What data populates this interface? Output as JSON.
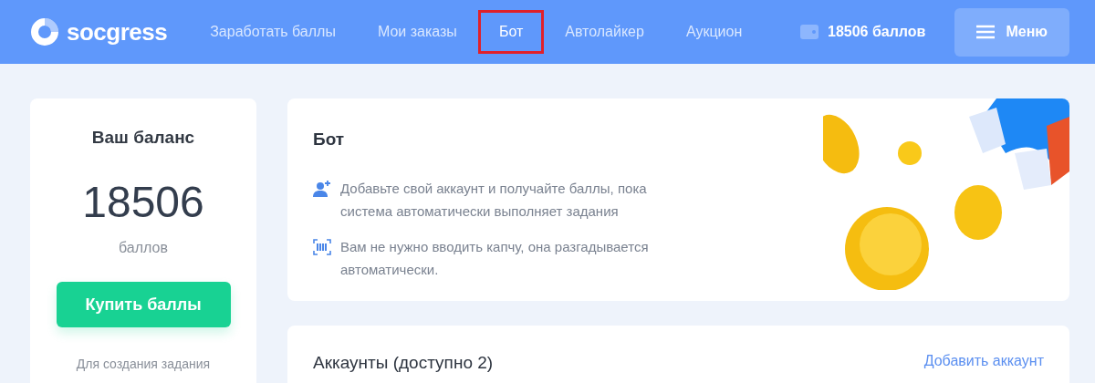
{
  "header": {
    "logo": "socgress",
    "nav": [
      {
        "label": "Заработать баллы",
        "selected": false,
        "highlighted": false
      },
      {
        "label": "Мои заказы",
        "selected": false,
        "highlighted": false
      },
      {
        "label": "Бот",
        "selected": true,
        "highlighted": true
      },
      {
        "label": "Автолайкер",
        "selected": false,
        "highlighted": false
      },
      {
        "label": "Аукцион",
        "selected": false,
        "highlighted": false
      }
    ],
    "balance": "18506 баллов",
    "menu_button": "Меню"
  },
  "balance_card": {
    "title": "Ваш баланс",
    "amount": "18506",
    "unit": "баллов",
    "buy_button": "Купить баллы",
    "note": "Для создания задания"
  },
  "bot_card": {
    "title": "Бот",
    "features": [
      {
        "kind": "account",
        "text": "Добавьте свой аккаунт и получайте баллы, пока система автоматически выполняет задания"
      },
      {
        "kind": "captcha",
        "text": "Вам не нужно вводить капчу, она разгадывается автоматически."
      }
    ]
  },
  "accounts_card": {
    "title": "Аккаунты (доступно 2)",
    "add_link": "Добавить аккаунт"
  }
}
